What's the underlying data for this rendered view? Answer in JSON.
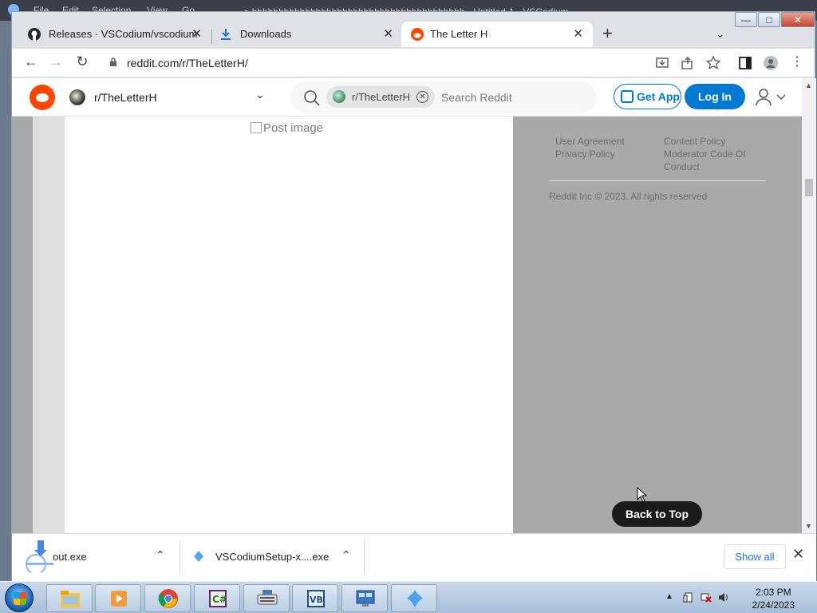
{
  "background_app": {
    "menu": [
      "File",
      "Edit",
      "Selection",
      "View",
      "Go",
      "..."
    ],
    "title": "● hhhhhhhhhhhhhhhhhhhhhhhhhhhhhhhhhhhhhhhh - Untitled-1 - VSCodium"
  },
  "browser": {
    "tabs": [
      {
        "title": "Releases · VSCodium/vscodium",
        "icon": "github-icon",
        "active": false
      },
      {
        "title": "Downloads",
        "icon": "download-icon",
        "active": false
      },
      {
        "title": "The Letter H",
        "icon": "reddit-icon",
        "active": true
      }
    ],
    "new_tab_label": "+",
    "url": "reddit.com/r/TheLetterH/"
  },
  "reddit": {
    "subreddit": "r/TheLetterH",
    "search_chip": "r/TheLetterH",
    "search_placeholder": "Search Reddit",
    "get_app": "Get App",
    "login": "Log In",
    "post_image_alt": "Post image",
    "footer_links_col1": [
      "User Agreement",
      "Privacy Policy"
    ],
    "footer_links_col2": [
      "Content Policy",
      "Moderator Code Of",
      "Conduct"
    ],
    "copyright": "Reddit Inc © 2023. All rights reserved",
    "back_to_top": "Back to Top"
  },
  "downloads": {
    "items": [
      {
        "name": "out.exe"
      },
      {
        "name": "VSCodiumSetup-x....exe"
      }
    ],
    "show_all": "Show all"
  },
  "taskbar": {
    "time": "2:03 PM",
    "date": "2/24/2023",
    "pinned": [
      "explorer-icon",
      "media-player-icon",
      "chrome-icon",
      "csharp-icon",
      "keyboard-icon",
      "visual-basic-icon",
      "remote-desktop-icon",
      "vscodium-icon"
    ]
  }
}
